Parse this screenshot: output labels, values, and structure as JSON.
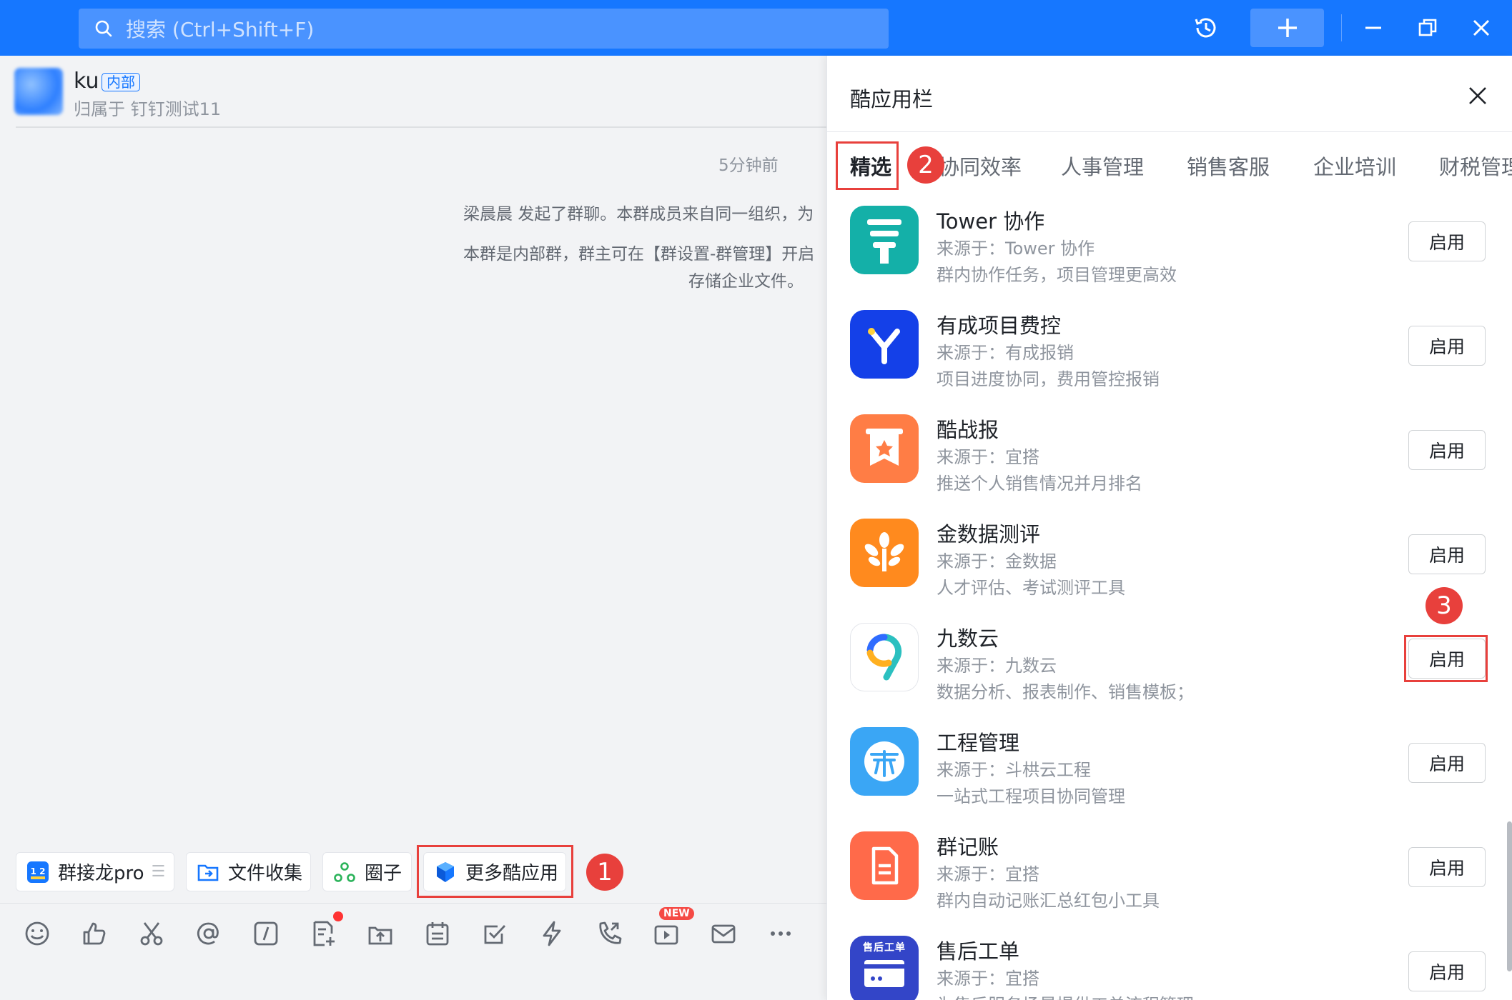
{
  "search": {
    "placeholder": "搜索 (Ctrl+Shift+F)"
  },
  "chat": {
    "name": "ku",
    "badge": "内部",
    "subtitle": "归属于 钉钉测试11",
    "time": "5分钟前",
    "messages": [
      "梁晨晨 发起了群聊。本群成员来自同一组织，为",
      "本群是内部群，群主可在【群设置-群管理】开启",
      "存储企业文件。"
    ]
  },
  "chips": [
    {
      "label": "群接龙pro",
      "icon": "solitaire-icon"
    },
    {
      "label": "文件收集",
      "icon": "file-collect-icon"
    },
    {
      "label": "圈子",
      "icon": "circle-icon"
    },
    {
      "label": "更多酷应用",
      "icon": "cube-icon"
    }
  ],
  "steps": {
    "s1": "1",
    "s2": "2",
    "s3": "3"
  },
  "toolbar": {
    "new_badge": "NEW"
  },
  "panel": {
    "title": "酷应用栏",
    "tabs": [
      "精选",
      "协同效率",
      "人事管理",
      "销售客服",
      "企业培训",
      "财税管理"
    ],
    "enable_label": "启用",
    "apps": [
      {
        "name": "Tower 协作",
        "source": "来源于：Tower 协作",
        "desc": "群内协作任务，项目管理更高效",
        "color": "#14b0a8"
      },
      {
        "name": "有成项目费控",
        "source": "来源于：有成报销",
        "desc": "项目进度协同，费用管控报销",
        "color": "#1440e8"
      },
      {
        "name": "酷战报",
        "source": "来源于：宜搭",
        "desc": "推送个人销售情况并月排名",
        "color": "#ff7d45"
      },
      {
        "name": "金数据测评",
        "source": "来源于：金数据",
        "desc": "人才评估、考试测评工具",
        "color": "#ff8a1e"
      },
      {
        "name": "九数云",
        "source": "来源于：九数云",
        "desc": "数据分析、报表制作、销售模板；",
        "color": "#ffffff"
      },
      {
        "name": "工程管理",
        "source": "来源于：斗栱云工程",
        "desc": "一站式工程项目协同管理",
        "color": "#3aa6f5"
      },
      {
        "name": "群记账",
        "source": "来源于：宜搭",
        "desc": "群内自动记账汇总红包小工具",
        "color": "#ff6a4a"
      },
      {
        "name": "售后工单",
        "source": "来源于：宜搭",
        "desc": "为售后服务场景提供工单流程管理",
        "color": "#3345c8",
        "icon_text": "售后工单"
      }
    ]
  }
}
